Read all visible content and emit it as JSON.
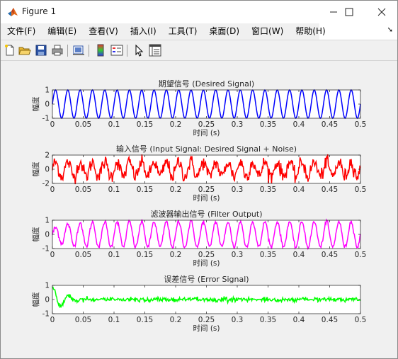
{
  "window": {
    "title": "Figure 1"
  },
  "menu": {
    "items": [
      "文件(F)",
      "编辑(E)",
      "查看(V)",
      "插入(I)",
      "工具(T)",
      "桌面(D)",
      "窗口(W)",
      "帮助(H)"
    ]
  },
  "toolbar": {
    "buttons": [
      "new-figure-icon",
      "open-file-icon",
      "save-icon",
      "print-icon",
      "link-plot-icon",
      "insert-colorbar-icon",
      "insert-legend-icon",
      "edit-plot-icon",
      "property-inspector-icon"
    ]
  },
  "chart_data": [
    {
      "type": "line",
      "title": "期望信号 (Desired Signal)",
      "xlabel": "时间 (s)",
      "ylabel": "幅度",
      "xlim": [
        0,
        0.5
      ],
      "ylim": [
        -1,
        1
      ],
      "xticks": [
        "0",
        "0.05",
        "0.1",
        "0.15",
        "0.2",
        "0.25",
        "0.3",
        "0.35",
        "0.4",
        "0.45",
        "0.5"
      ],
      "yticks": [
        "-1",
        "0",
        "1"
      ],
      "color": "#0000ff",
      "series": [
        {
          "kind": "sine",
          "frequency_hz": 50,
          "amplitude": 1
        }
      ]
    },
    {
      "type": "line",
      "title": "输入信号 (Input Signal: Desired Signal + Noise)",
      "xlabel": "时间 (s)",
      "ylabel": "幅度",
      "xlim": [
        0,
        0.5
      ],
      "ylim": [
        -2,
        2
      ],
      "xticks": [
        "0",
        "0.05",
        "0.1",
        "0.15",
        "0.2",
        "0.25",
        "0.3",
        "0.35",
        "0.4",
        "0.45",
        "0.5"
      ],
      "yticks": [
        "-2",
        "0",
        "2"
      ],
      "color": "#ff0000",
      "series": [
        {
          "kind": "sine_plus_noise",
          "frequency_hz": 50,
          "amplitude": 1,
          "noise_std": 0.5
        }
      ]
    },
    {
      "type": "line",
      "title": "滤波器输出信号 (Filter Output)",
      "xlabel": "时间 (s)",
      "ylabel": "幅度",
      "xlim": [
        0,
        0.5
      ],
      "ylim": [
        -1,
        1
      ],
      "xticks": [
        "0",
        "0.05",
        "0.1",
        "0.15",
        "0.2",
        "0.25",
        "0.3",
        "0.35",
        "0.4",
        "0.45",
        "0.5"
      ],
      "yticks": [
        "-1",
        "0",
        "1"
      ],
      "color": "#ff00ff",
      "series": [
        {
          "kind": "adaptive_output",
          "frequency_hz": 50,
          "amplitude": 1
        }
      ]
    },
    {
      "type": "line",
      "title": "误差信号 (Error Signal)",
      "xlabel": "时间 (s)",
      "ylabel": "幅度",
      "xlim": [
        0,
        0.5
      ],
      "ylim": [
        -1,
        1
      ],
      "xticks": [
        "0",
        "0.05",
        "0.1",
        "0.15",
        "0.2",
        "0.25",
        "0.3",
        "0.35",
        "0.4",
        "0.45",
        "0.5"
      ],
      "yticks": [
        "-1",
        "0",
        "1"
      ],
      "color": "#00ff00",
      "series": [
        {
          "kind": "adaptive_error",
          "frequency_hz": 50
        }
      ]
    }
  ]
}
